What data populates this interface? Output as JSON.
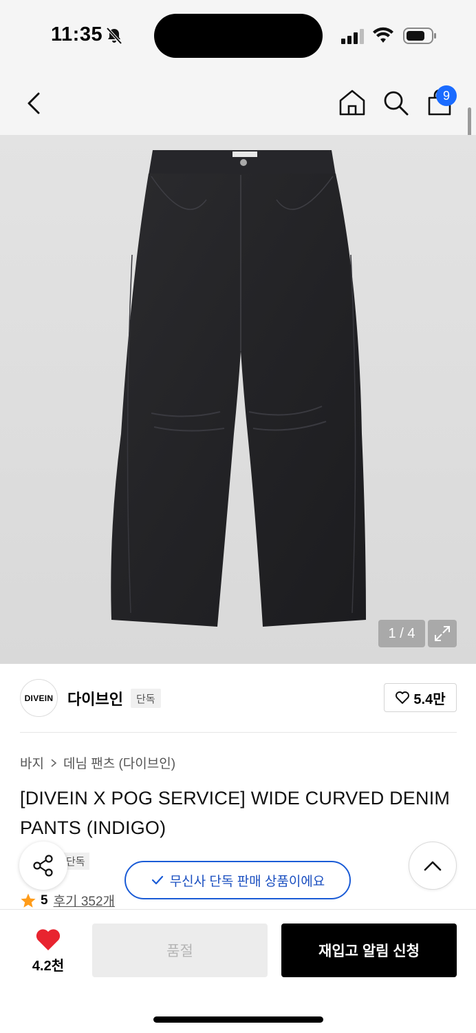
{
  "status_bar": {
    "time": "11:35",
    "icons": [
      "bell-slash-icon",
      "signal-icon",
      "wifi-icon",
      "battery-icon"
    ]
  },
  "nav": {
    "icons": [
      "back-icon",
      "home-icon",
      "search-icon",
      "shopping-bag-icon"
    ],
    "cart_count": "9"
  },
  "gallery": {
    "counter": "1 / 4",
    "expand_icon": "expand-icon",
    "current_index": 1,
    "total": 4
  },
  "brand": {
    "logo_text": "DIVEIN",
    "name": "다이브인",
    "badge": "단독",
    "like_count": "5.4만"
  },
  "breadcrumb": {
    "category": "바지",
    "subcategory": "데님 팬츠 (다이브인)"
  },
  "product": {
    "title": "[DIVEIN X POG SERVICE] WIDE CURVED DENIM PANTS (INDIGO)",
    "exclusive_tag": "단독",
    "rating": "5",
    "review_label": "후기 352개"
  },
  "floating": {
    "exclusive_notice": "무신사 단독 판매 상품이에요"
  },
  "bottom_bar": {
    "wish_count": "4.2천",
    "soldout_label": "품절",
    "restock_label": "재입고 알림 신청"
  },
  "colors": {
    "accent_blue": "#1a5bd6",
    "badge_blue": "#1a6bff",
    "heart_red": "#e8242f",
    "star_orange": "#ff9c1a",
    "primary_button": "#000000"
  }
}
